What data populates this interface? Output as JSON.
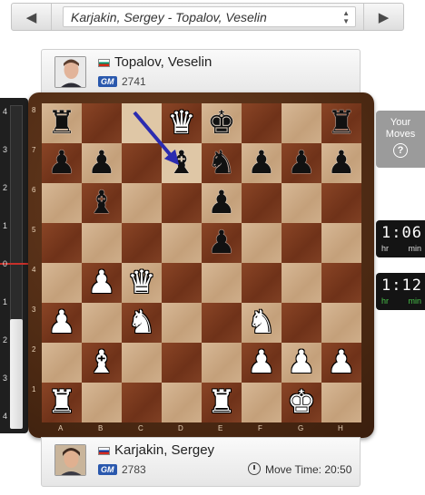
{
  "nav": {
    "prev_glyph": "◀",
    "next_glyph": "▶",
    "game_title": "Karjakin, Sergey - Topalov, Veselin",
    "updown_glyph_up": "▲",
    "updown_glyph_down": "▼"
  },
  "players": {
    "top": {
      "name": "Topalov, Veselin",
      "title": "GM",
      "rating": "2741",
      "flag": "bulgaria"
    },
    "bottom": {
      "name": "Karjakin, Sergey",
      "title": "GM",
      "rating": "2783",
      "flag": "russia",
      "move_time_label": "Move Time: 20:50"
    }
  },
  "your_moves": {
    "label_line1": "Your",
    "label_line2": "Moves",
    "help_glyph": "?"
  },
  "clocks": {
    "top": {
      "time": "1:06",
      "unit_hr": "hr",
      "unit_min": "min"
    },
    "bottom": {
      "time": "1:12",
      "unit_hr": "hr",
      "unit_min": "min"
    }
  },
  "eval_meter": {
    "ticks": [
      "4",
      "3",
      "2",
      "1",
      "0",
      "1",
      "2",
      "3",
      "4"
    ],
    "level_fraction": 0.34,
    "zero_color": "#c8302a"
  },
  "board": {
    "ranks": [
      "8",
      "7",
      "6",
      "5",
      "4",
      "3",
      "2",
      "1"
    ],
    "files": [
      "A",
      "B",
      "C",
      "D",
      "E",
      "F",
      "G",
      "H"
    ],
    "rows": [
      [
        "br",
        "",
        "",
        "wq",
        "bk",
        "",
        "",
        "br"
      ],
      [
        "bp",
        "bp",
        "",
        "bb",
        "bn",
        "bp",
        "bp",
        "bp"
      ],
      [
        "",
        "bb",
        "",
        "",
        "bp",
        "",
        "",
        ""
      ],
      [
        "",
        "",
        "",
        "",
        "bp",
        "",
        "",
        ""
      ],
      [
        "",
        "wp",
        "wq",
        "",
        "",
        "",
        "",
        ""
      ],
      [
        "wp",
        "",
        "wn",
        "",
        "",
        "wn",
        "",
        ""
      ],
      [
        "",
        "wb",
        "",
        "",
        "",
        "wp",
        "wp",
        "wp"
      ],
      [
        "wr",
        "",
        "",
        "",
        "wr",
        "",
        "wk",
        ""
      ]
    ],
    "last_move": {
      "from": "c8",
      "to": "d7"
    },
    "arrow_color": "#2b2bb0"
  }
}
